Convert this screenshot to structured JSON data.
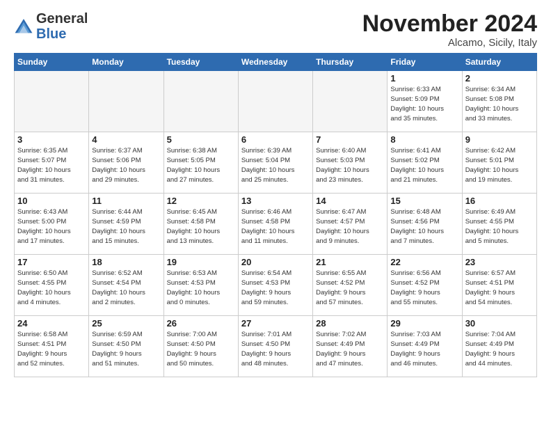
{
  "header": {
    "logo_general": "General",
    "logo_blue": "Blue",
    "month_title": "November 2024",
    "subtitle": "Alcamo, Sicily, Italy"
  },
  "weekdays": [
    "Sunday",
    "Monday",
    "Tuesday",
    "Wednesday",
    "Thursday",
    "Friday",
    "Saturday"
  ],
  "weeks": [
    [
      {
        "day": "",
        "info": ""
      },
      {
        "day": "",
        "info": ""
      },
      {
        "day": "",
        "info": ""
      },
      {
        "day": "",
        "info": ""
      },
      {
        "day": "",
        "info": ""
      },
      {
        "day": "1",
        "info": "Sunrise: 6:33 AM\nSunset: 5:09 PM\nDaylight: 10 hours\nand 35 minutes."
      },
      {
        "day": "2",
        "info": "Sunrise: 6:34 AM\nSunset: 5:08 PM\nDaylight: 10 hours\nand 33 minutes."
      }
    ],
    [
      {
        "day": "3",
        "info": "Sunrise: 6:35 AM\nSunset: 5:07 PM\nDaylight: 10 hours\nand 31 minutes."
      },
      {
        "day": "4",
        "info": "Sunrise: 6:37 AM\nSunset: 5:06 PM\nDaylight: 10 hours\nand 29 minutes."
      },
      {
        "day": "5",
        "info": "Sunrise: 6:38 AM\nSunset: 5:05 PM\nDaylight: 10 hours\nand 27 minutes."
      },
      {
        "day": "6",
        "info": "Sunrise: 6:39 AM\nSunset: 5:04 PM\nDaylight: 10 hours\nand 25 minutes."
      },
      {
        "day": "7",
        "info": "Sunrise: 6:40 AM\nSunset: 5:03 PM\nDaylight: 10 hours\nand 23 minutes."
      },
      {
        "day": "8",
        "info": "Sunrise: 6:41 AM\nSunset: 5:02 PM\nDaylight: 10 hours\nand 21 minutes."
      },
      {
        "day": "9",
        "info": "Sunrise: 6:42 AM\nSunset: 5:01 PM\nDaylight: 10 hours\nand 19 minutes."
      }
    ],
    [
      {
        "day": "10",
        "info": "Sunrise: 6:43 AM\nSunset: 5:00 PM\nDaylight: 10 hours\nand 17 minutes."
      },
      {
        "day": "11",
        "info": "Sunrise: 6:44 AM\nSunset: 4:59 PM\nDaylight: 10 hours\nand 15 minutes."
      },
      {
        "day": "12",
        "info": "Sunrise: 6:45 AM\nSunset: 4:58 PM\nDaylight: 10 hours\nand 13 minutes."
      },
      {
        "day": "13",
        "info": "Sunrise: 6:46 AM\nSunset: 4:58 PM\nDaylight: 10 hours\nand 11 minutes."
      },
      {
        "day": "14",
        "info": "Sunrise: 6:47 AM\nSunset: 4:57 PM\nDaylight: 10 hours\nand 9 minutes."
      },
      {
        "day": "15",
        "info": "Sunrise: 6:48 AM\nSunset: 4:56 PM\nDaylight: 10 hours\nand 7 minutes."
      },
      {
        "day": "16",
        "info": "Sunrise: 6:49 AM\nSunset: 4:55 PM\nDaylight: 10 hours\nand 5 minutes."
      }
    ],
    [
      {
        "day": "17",
        "info": "Sunrise: 6:50 AM\nSunset: 4:55 PM\nDaylight: 10 hours\nand 4 minutes."
      },
      {
        "day": "18",
        "info": "Sunrise: 6:52 AM\nSunset: 4:54 PM\nDaylight: 10 hours\nand 2 minutes."
      },
      {
        "day": "19",
        "info": "Sunrise: 6:53 AM\nSunset: 4:53 PM\nDaylight: 10 hours\nand 0 minutes."
      },
      {
        "day": "20",
        "info": "Sunrise: 6:54 AM\nSunset: 4:53 PM\nDaylight: 9 hours\nand 59 minutes."
      },
      {
        "day": "21",
        "info": "Sunrise: 6:55 AM\nSunset: 4:52 PM\nDaylight: 9 hours\nand 57 minutes."
      },
      {
        "day": "22",
        "info": "Sunrise: 6:56 AM\nSunset: 4:52 PM\nDaylight: 9 hours\nand 55 minutes."
      },
      {
        "day": "23",
        "info": "Sunrise: 6:57 AM\nSunset: 4:51 PM\nDaylight: 9 hours\nand 54 minutes."
      }
    ],
    [
      {
        "day": "24",
        "info": "Sunrise: 6:58 AM\nSunset: 4:51 PM\nDaylight: 9 hours\nand 52 minutes."
      },
      {
        "day": "25",
        "info": "Sunrise: 6:59 AM\nSunset: 4:50 PM\nDaylight: 9 hours\nand 51 minutes."
      },
      {
        "day": "26",
        "info": "Sunrise: 7:00 AM\nSunset: 4:50 PM\nDaylight: 9 hours\nand 50 minutes."
      },
      {
        "day": "27",
        "info": "Sunrise: 7:01 AM\nSunset: 4:50 PM\nDaylight: 9 hours\nand 48 minutes."
      },
      {
        "day": "28",
        "info": "Sunrise: 7:02 AM\nSunset: 4:49 PM\nDaylight: 9 hours\nand 47 minutes."
      },
      {
        "day": "29",
        "info": "Sunrise: 7:03 AM\nSunset: 4:49 PM\nDaylight: 9 hours\nand 46 minutes."
      },
      {
        "day": "30",
        "info": "Sunrise: 7:04 AM\nSunset: 4:49 PM\nDaylight: 9 hours\nand 44 minutes."
      }
    ]
  ]
}
